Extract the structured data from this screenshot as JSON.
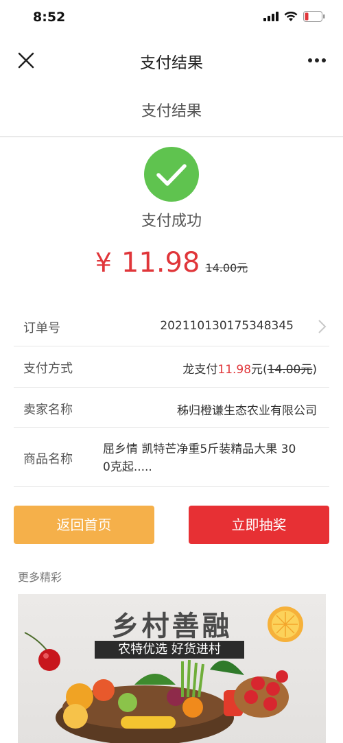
{
  "status_bar": {
    "time": "8:52"
  },
  "nav": {
    "title": "支付结果"
  },
  "page": {
    "header_title": "支付结果"
  },
  "result": {
    "status_text": "支付成功",
    "currency_symbol": "¥",
    "amount": "11.98",
    "original_amount": "14.00元"
  },
  "details": {
    "order_no_label": "订单号",
    "order_no_value": "202110130175348345",
    "pay_method_label": "支付方式",
    "pay_method_prefix": "龙支付",
    "pay_method_amount": "11.98",
    "pay_method_unit": "元(",
    "pay_method_original": "14.00元",
    "pay_method_close": ")",
    "seller_label": "卖家名称",
    "seller_value": "秭归橙谦生态农业有限公司",
    "product_label": "商品名称",
    "product_line1": "屈乡情 凯特芒净重5斤装精品大果 30",
    "product_line2": "0克起....."
  },
  "buttons": {
    "home": "返回首页",
    "lottery": "立即抽奖"
  },
  "more": {
    "title": "更多精彩"
  },
  "banner": {
    "title": "乡村善融",
    "subtitle": "农特优选 好货进村"
  },
  "colors": {
    "accent_red": "#e0363a",
    "success_green": "#5fc34f",
    "button_orange": "#f5b04a",
    "button_red": "#e73034"
  }
}
